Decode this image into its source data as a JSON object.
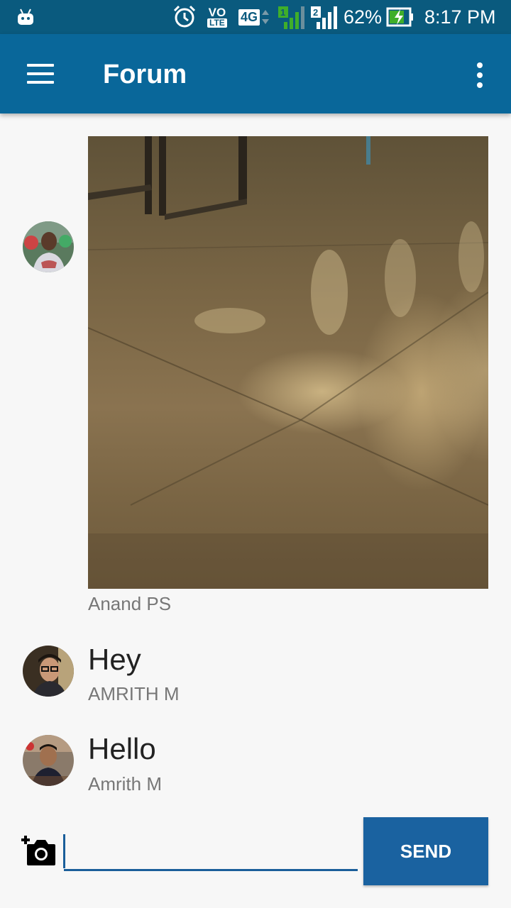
{
  "status_bar": {
    "network_label": "VO",
    "lte_label": "LTE",
    "network_type": "4G",
    "sim1": "1",
    "sim2": "2",
    "battery": "62%",
    "time": "8:17 PM",
    "icons": [
      "android-icon",
      "alarm-icon",
      "volte-icon",
      "4g-icon",
      "signal-sim1-icon",
      "signal-sim2-icon",
      "battery-charging-icon"
    ]
  },
  "app_bar": {
    "title": "Forum",
    "menu_icon": "hamburger-menu-icon",
    "overflow_icon": "more-vert-icon",
    "color": "#09679a"
  },
  "messages": [
    {
      "type": "image",
      "sender": "Anand PS"
    },
    {
      "type": "text",
      "text": "Hey",
      "sender": "AMRITH M"
    },
    {
      "type": "text",
      "text": "Hello",
      "sender": "Amrith M"
    }
  ],
  "composer": {
    "camera_icon": "add-photo-icon",
    "input_value": "",
    "send_label": "SEND",
    "accent": "#1a62a0"
  }
}
